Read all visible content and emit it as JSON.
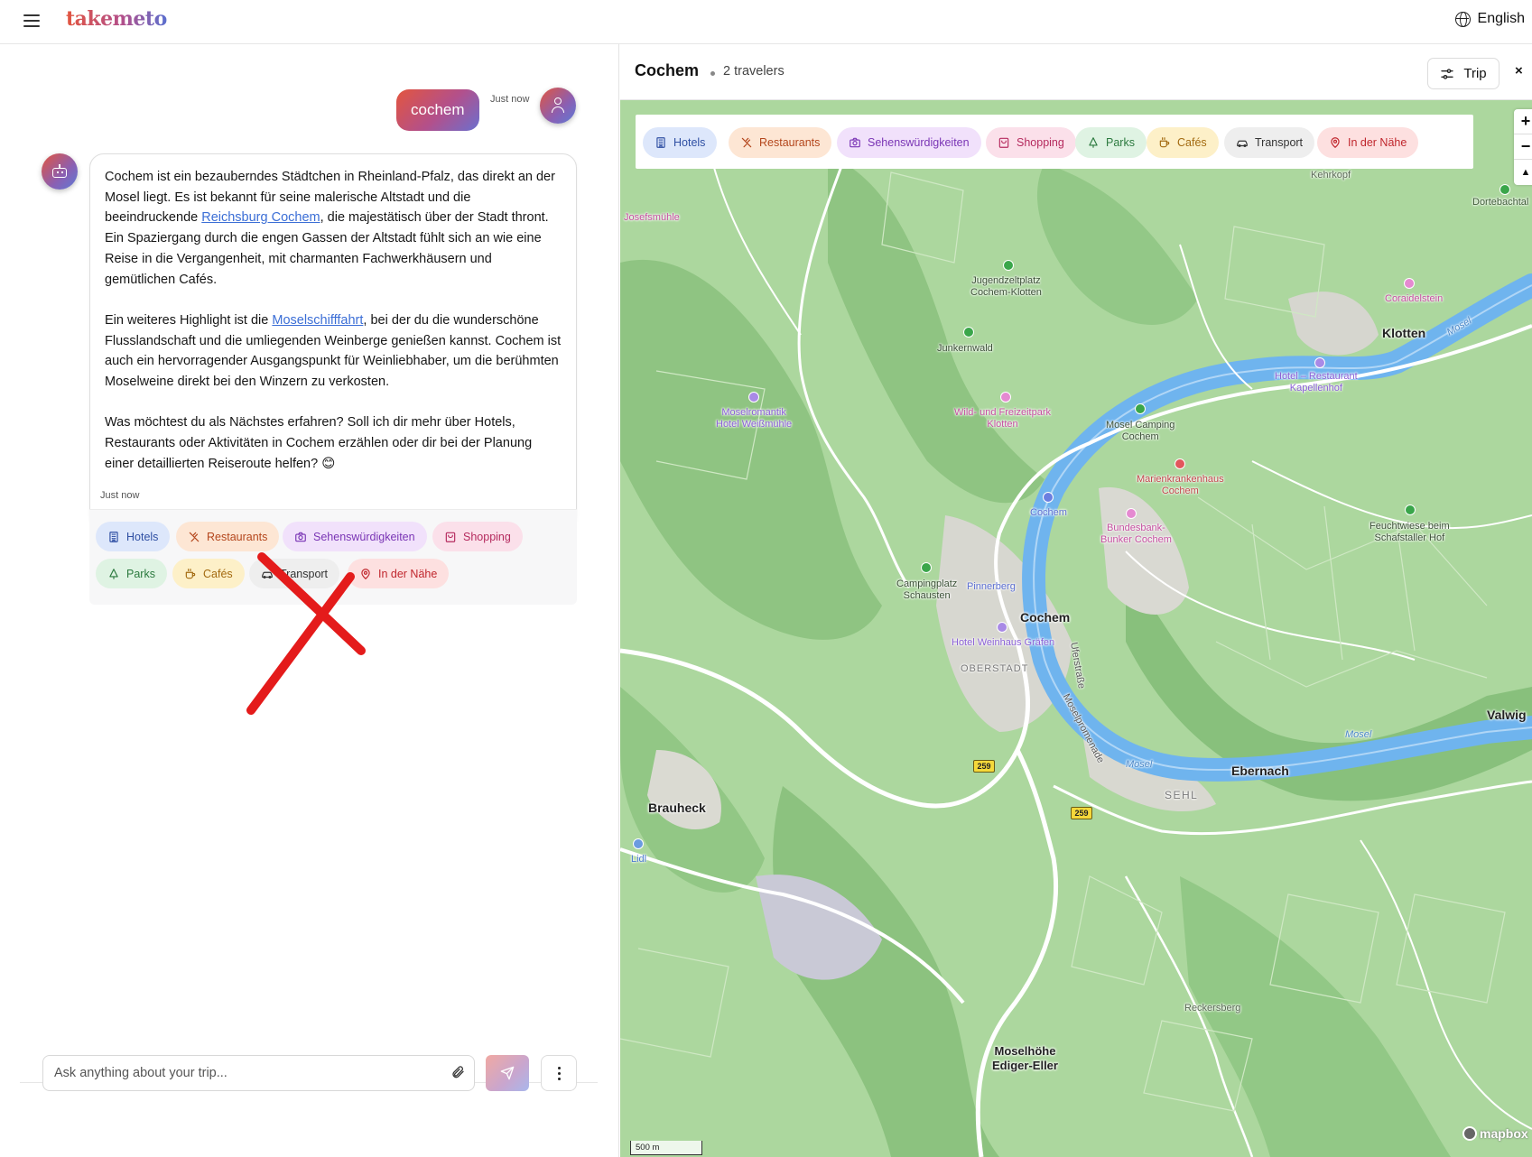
{
  "app": {
    "logo": "takemeto",
    "language": "English"
  },
  "chat": {
    "user_message": "cochem",
    "user_time": "Just now",
    "bot_paragraphs": [
      {
        "before": "Cochem ist ein bezauberndes Städtchen in Rheinland-Pfalz, das direkt an der Mosel liegt. Es ist bekannt für seine malerische Altstadt und die beeindruckende ",
        "link": "Reichsburg Cochem",
        "after": ", die majestätisch über der Stadt thront. Ein Spaziergang durch die engen Gassen der Altstadt fühlt sich an wie eine Reise in die Vergangenheit, mit charmanten Fachwerkhäusern und gemütlichen Cafés."
      },
      {
        "before": "Ein weiteres Highlight ist die ",
        "link": "Moselschifffahrt",
        "after": ", bei der du die wunderschöne Flusslandschaft und die umliegenden Weinberge genießen kannst. Cochem ist auch ein hervorragender Ausgangspunkt für Weinliebhaber, um die berühmten Moselweine direkt bei den Winzern zu verkosten."
      },
      {
        "before": "Was möchtest du als Nächstes erfahren? Soll ich dir mehr über Hotels, Restaurants oder Aktivitäten in Cochem erzählen oder dir bei der Planung einer detaillierten Reiseroute helfen? 😊",
        "link": "",
        "after": ""
      }
    ],
    "bot_time": "Just now",
    "chips": [
      {
        "label": "Hotels",
        "icon": "hotel-icon",
        "bg": "#dde7fb",
        "fg": "#2f4fa3"
      },
      {
        "label": "Restaurants",
        "icon": "utensils-icon",
        "bg": "#fde6d4",
        "fg": "#b4461c"
      },
      {
        "label": "Sehenswürdigkeiten",
        "icon": "camera-icon",
        "bg": "#f1e1fb",
        "fg": "#7a35b5"
      },
      {
        "label": "Shopping",
        "icon": "shopping-bag-icon",
        "bg": "#fbe0ea",
        "fg": "#b52a5e"
      },
      {
        "label": "Parks",
        "icon": "tree-icon",
        "bg": "#dff3e3",
        "fg": "#2c7a3f"
      },
      {
        "label": "Cafés",
        "icon": "coffee-icon",
        "bg": "#fdf0c8",
        "fg": "#a36a10"
      },
      {
        "label": "Transport",
        "icon": "car-icon",
        "bg": "#eeeeee",
        "fg": "#333333"
      },
      {
        "label": "In der Nähe",
        "icon": "location-pin-icon",
        "bg": "#fde0e0",
        "fg": "#c0262d"
      }
    ],
    "input_placeholder": "Ask anything about your trip..."
  },
  "map": {
    "title": "Cochem",
    "subtitle": "2 travelers",
    "trip_button": "Trip",
    "close": "×",
    "filters": [
      {
        "label": "Hotels",
        "icon": "hotel-icon",
        "bg": "#dde7fb",
        "fg": "#2f4fa3"
      },
      {
        "label": "Restaurants",
        "icon": "utensils-icon",
        "bg": "#fde6d4",
        "fg": "#b4461c"
      },
      {
        "label": "Sehenswürdigkeiten",
        "icon": "camera-icon",
        "bg": "#f1e1fb",
        "fg": "#7a35b5"
      },
      {
        "label": "Shopping",
        "icon": "shopping-bag-icon",
        "bg": "#fbe0ea",
        "fg": "#b52a5e"
      },
      {
        "label": "Parks",
        "icon": "tree-icon",
        "bg": "#dff3e3",
        "fg": "#2c7a3f"
      },
      {
        "label": "Cafés",
        "icon": "coffee-icon",
        "bg": "#fdf0c8",
        "fg": "#a36a10"
      },
      {
        "label": "Transport",
        "icon": "car-icon",
        "bg": "#eeeeee",
        "fg": "#333333"
      },
      {
        "label": "In der Nähe",
        "icon": "location-pin-icon",
        "bg": "#fde0e0",
        "fg": "#c0262d"
      }
    ],
    "zoom_in": "+",
    "zoom_out": "−",
    "compass": "▲",
    "places": {
      "kehrkopf": "Kehrkopf",
      "dortebachtal": "Dortebachtal",
      "josefsmuehle": "Josefsmühle",
      "jugendzeltplatz": "Jugendzeltplatz\nCochem-Klotten",
      "coraidelstein": "Coraidelstein",
      "junkernwald": "Junkernwald",
      "klotten": "Klotten",
      "hotel_kapellenhof": "Hotel – Restaurant\nKapellenhof",
      "moselromantik": "Moselromantik\nHotel Weißmühle",
      "wildpark": "Wild- und Freizeitpark\nKlotten",
      "moselcamping": "Mosel Camping\nCochem",
      "marienkrankenhaus": "Marienkrankenhaus\nCochem",
      "cochem_station": "Cochem",
      "bundesbank": "Bundesbank-\nBunker Cochem",
      "feuchtwiese": "Feuchtwiese beim\nSchafstaller Hof",
      "campingplatz": "Campingplatz\nSchausten",
      "pinnerberg": "Pinnerberg",
      "cochem": "Cochem",
      "hotel_weinhaus": "Hotel Weinhaus Gräfen",
      "oberstadt": "OBERSTADT",
      "uferstrasse": "Uferstraße",
      "moselpromenade": "Moselpromenade",
      "valwig": "Valwig",
      "ebernach": "Ebernach",
      "sehl": "SEHL",
      "brauheck": "Brauheck",
      "lidl": "Lidl",
      "reckersberg": "Reckersberg",
      "moselhoehe": "Moselhöhe\nEdiger-Eller",
      "river_mosel": "Mosel",
      "road_259": "259"
    },
    "scale_label": "500 m",
    "attribution": "mapbox",
    "colors": {
      "land": "#a9d49a",
      "forest": "#8cc47e",
      "water": "#6fb4ee",
      "road": "#ffffff"
    }
  }
}
